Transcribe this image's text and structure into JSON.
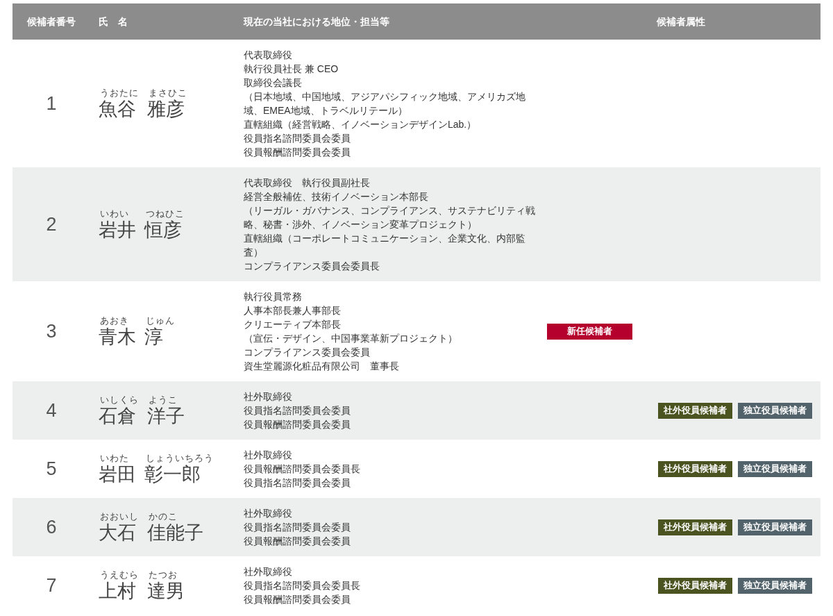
{
  "table": {
    "columns": [
      "候補者番号",
      "氏　名",
      "現在の当社における地位・担当等",
      "候補者属性"
    ],
    "rows": [
      {
        "number": "1",
        "name": [
          {
            "kanji": "魚谷",
            "reading": "うおたに"
          },
          {
            "kanji": "雅彦",
            "reading": "まさひこ"
          }
        ],
        "position": [
          "代表取締役",
          "執行役員社長 兼 CEO",
          "取締役会議長",
          "（日本地域、中国地域、アジアパシフィック地域、アメリカズ地域、EMEA地域、トラベルリテール）",
          "直轄組織（経営戦略、イノベーションデザインLab.）",
          "役員指名諮問委員会委員",
          "役員報酬諮問委員会委員"
        ],
        "attributes": []
      },
      {
        "number": "2",
        "name": [
          {
            "kanji": "岩井",
            "reading": "いわい"
          },
          {
            "kanji": "恒彦",
            "reading": "つねひこ"
          }
        ],
        "position": [
          "代表取締役　執行役員副社長",
          "経営全般補佐、技術イノベーション本部長",
          "（リーガル・ガバナンス、コンプライアンス、サステナビリティ戦略、秘書・渉外、イノベーション変革プロジェクト）",
          "直轄組織（コーポレートコミュニケーション、企業文化、内部監査）",
          "コンプライアンス委員会委員長"
        ],
        "attributes": []
      },
      {
        "number": "3",
        "name": [
          {
            "kanji": "青木",
            "reading": "あおき"
          },
          {
            "kanji": "淳",
            "reading": "じゅん"
          }
        ],
        "position": [
          "執行役員常務",
          "人事本部長兼人事部長",
          "クリエーティブ本部長",
          "（宣伝・デザイン、中国事業革新プロジェクト）",
          "コンプライアンス委員会委員",
          "資生堂麗源化粧品有限公司　董事長"
        ],
        "attributes": [
          {
            "kind": "new",
            "label": "新任候補者"
          }
        ]
      },
      {
        "number": "4",
        "name": [
          {
            "kanji": "石倉",
            "reading": "いしくら"
          },
          {
            "kanji": "洋子",
            "reading": "ようこ"
          }
        ],
        "position": [
          "社外取締役",
          "役員指名諮問委員会委員",
          "役員報酬諮問委員会委員"
        ],
        "attributes": [
          {
            "kind": "outside",
            "label": "社外役員候補者"
          },
          {
            "kind": "independent",
            "label": "独立役員候補者"
          }
        ]
      },
      {
        "number": "5",
        "name": [
          {
            "kanji": "岩田",
            "reading": "いわた"
          },
          {
            "kanji": "彰一郎",
            "reading": "しょういちろう"
          }
        ],
        "position": [
          "社外取締役",
          "役員報酬諮問委員会委員長",
          "役員指名諮問委員会委員"
        ],
        "attributes": [
          {
            "kind": "outside",
            "label": "社外役員候補者"
          },
          {
            "kind": "independent",
            "label": "独立役員候補者"
          }
        ]
      },
      {
        "number": "6",
        "name": [
          {
            "kanji": "大石",
            "reading": "おおいし"
          },
          {
            "kanji": "佳能子",
            "reading": "かのこ"
          }
        ],
        "position": [
          "社外取締役",
          "役員指名諮問委員会委員",
          "役員報酬諮問委員会委員"
        ],
        "attributes": [
          {
            "kind": "outside",
            "label": "社外役員候補者"
          },
          {
            "kind": "independent",
            "label": "独立役員候補者"
          }
        ]
      },
      {
        "number": "7",
        "name": [
          {
            "kanji": "上村",
            "reading": "うえむら"
          },
          {
            "kanji": "達男",
            "reading": "たつお"
          }
        ],
        "position": [
          "社外取締役",
          "役員指名諮問委員会委員長",
          "役員報酬諮問委員会委員"
        ],
        "attributes": [
          {
            "kind": "outside",
            "label": "社外役員候補者"
          },
          {
            "kind": "independent",
            "label": "独立役員候補者"
          }
        ]
      }
    ]
  }
}
